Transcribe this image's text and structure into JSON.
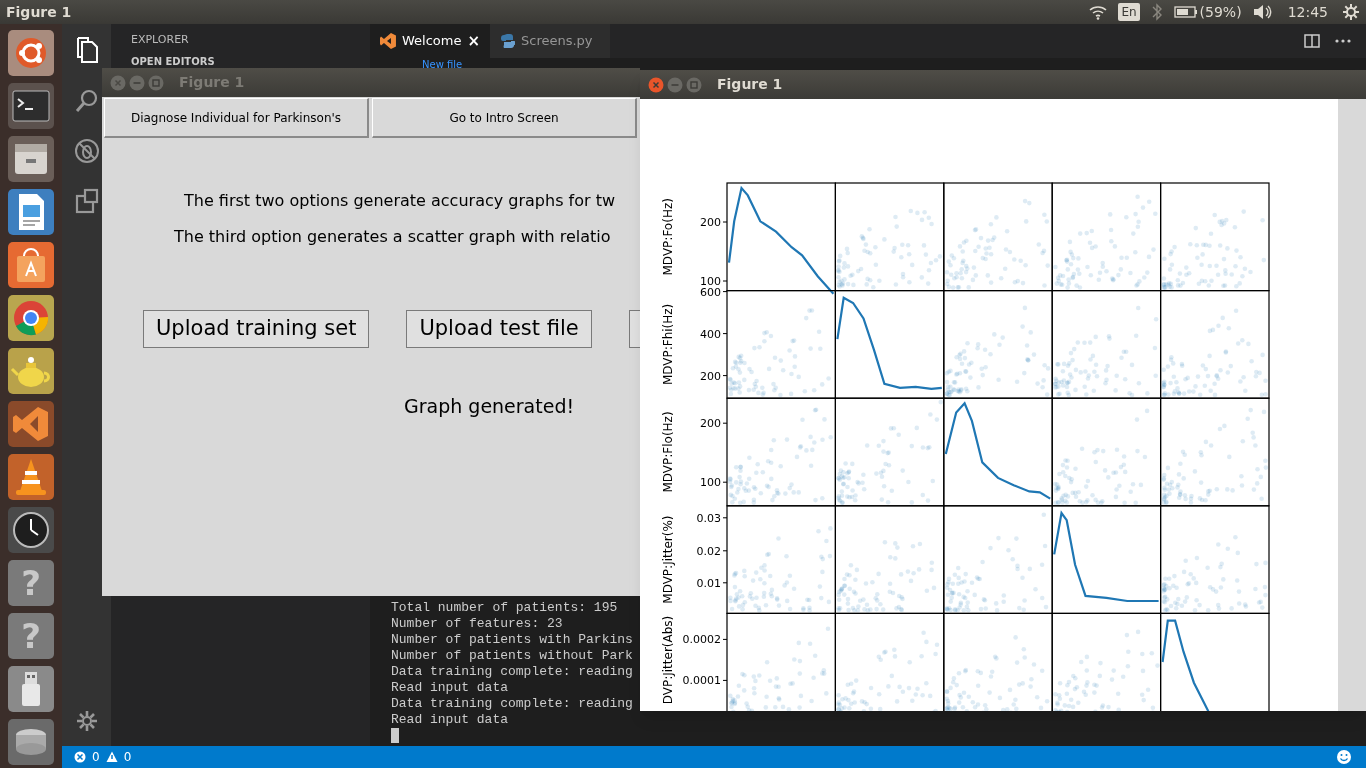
{
  "top_panel": {
    "title": "Figure 1",
    "keyboard": "En",
    "battery": "(59%)",
    "clock": "12:45"
  },
  "launcher": [
    {
      "kind": "logo"
    },
    {
      "kind": "terminal"
    },
    {
      "kind": "files"
    },
    {
      "kind": "document"
    },
    {
      "kind": "store"
    },
    {
      "kind": "browser"
    },
    {
      "kind": "teapot"
    },
    {
      "kind": "editor"
    },
    {
      "kind": "cone"
    },
    {
      "kind": "clock"
    },
    {
      "kind": "unknown",
      "glyph": "?"
    },
    {
      "kind": "unknown",
      "glyph": "?"
    },
    {
      "kind": "usb"
    },
    {
      "kind": "drive"
    }
  ],
  "editor": {
    "sidebar_title": "EXPLORER",
    "section": "OPEN EDITORS",
    "tabs": [
      {
        "label": "Welcome",
        "selected": true,
        "kind": "welcome",
        "close": "×"
      },
      {
        "label": "Screens.py",
        "selected": false,
        "kind": "python"
      }
    ],
    "welcome_link": "New file",
    "terminal_lines": [
      "Total number of patients: 195",
      "Number of features: 23",
      "Number of patients with Parkins",
      "Number of patients without Park",
      "Data training complete: reading",
      "Read input data",
      "Data training complete: reading",
      "Read input data"
    ],
    "status_bar": {
      "errors": "0",
      "warnings": "0"
    }
  },
  "figure_left": {
    "title": "Figure 1",
    "nav_buttons": [
      "Diagnose Individual for Parkinson's",
      "Go to Intro Screen"
    ],
    "info_lines": [
      "The first two options generate accuracy graphs for tw",
      "The third option generates a scatter graph with relatio"
    ],
    "action_buttons": [
      "Upload training set",
      "Upload test file"
    ],
    "status": "Graph generated!"
  },
  "figure_right": {
    "title": "Figure 1",
    "scatter_matrix": {
      "rows": [
        {
          "label": "MDVP:Fo(Hz)",
          "ticks": [
            "200",
            "100"
          ]
        },
        {
          "label": "MDVP:Fhi(Hz)",
          "ticks": [
            "600",
            "400",
            "200"
          ]
        },
        {
          "label": "MDVP:Flo(Hz)",
          "ticks": [
            "200",
            "100"
          ]
        },
        {
          "label": "MDVP:Jitter(%)",
          "ticks": [
            "0.03",
            "0.02",
            "0.01"
          ]
        },
        {
          "label": "DVP:Jitter(Abs)",
          "ticks": [
            "0.0002",
            "0.0001"
          ]
        }
      ]
    }
  }
}
